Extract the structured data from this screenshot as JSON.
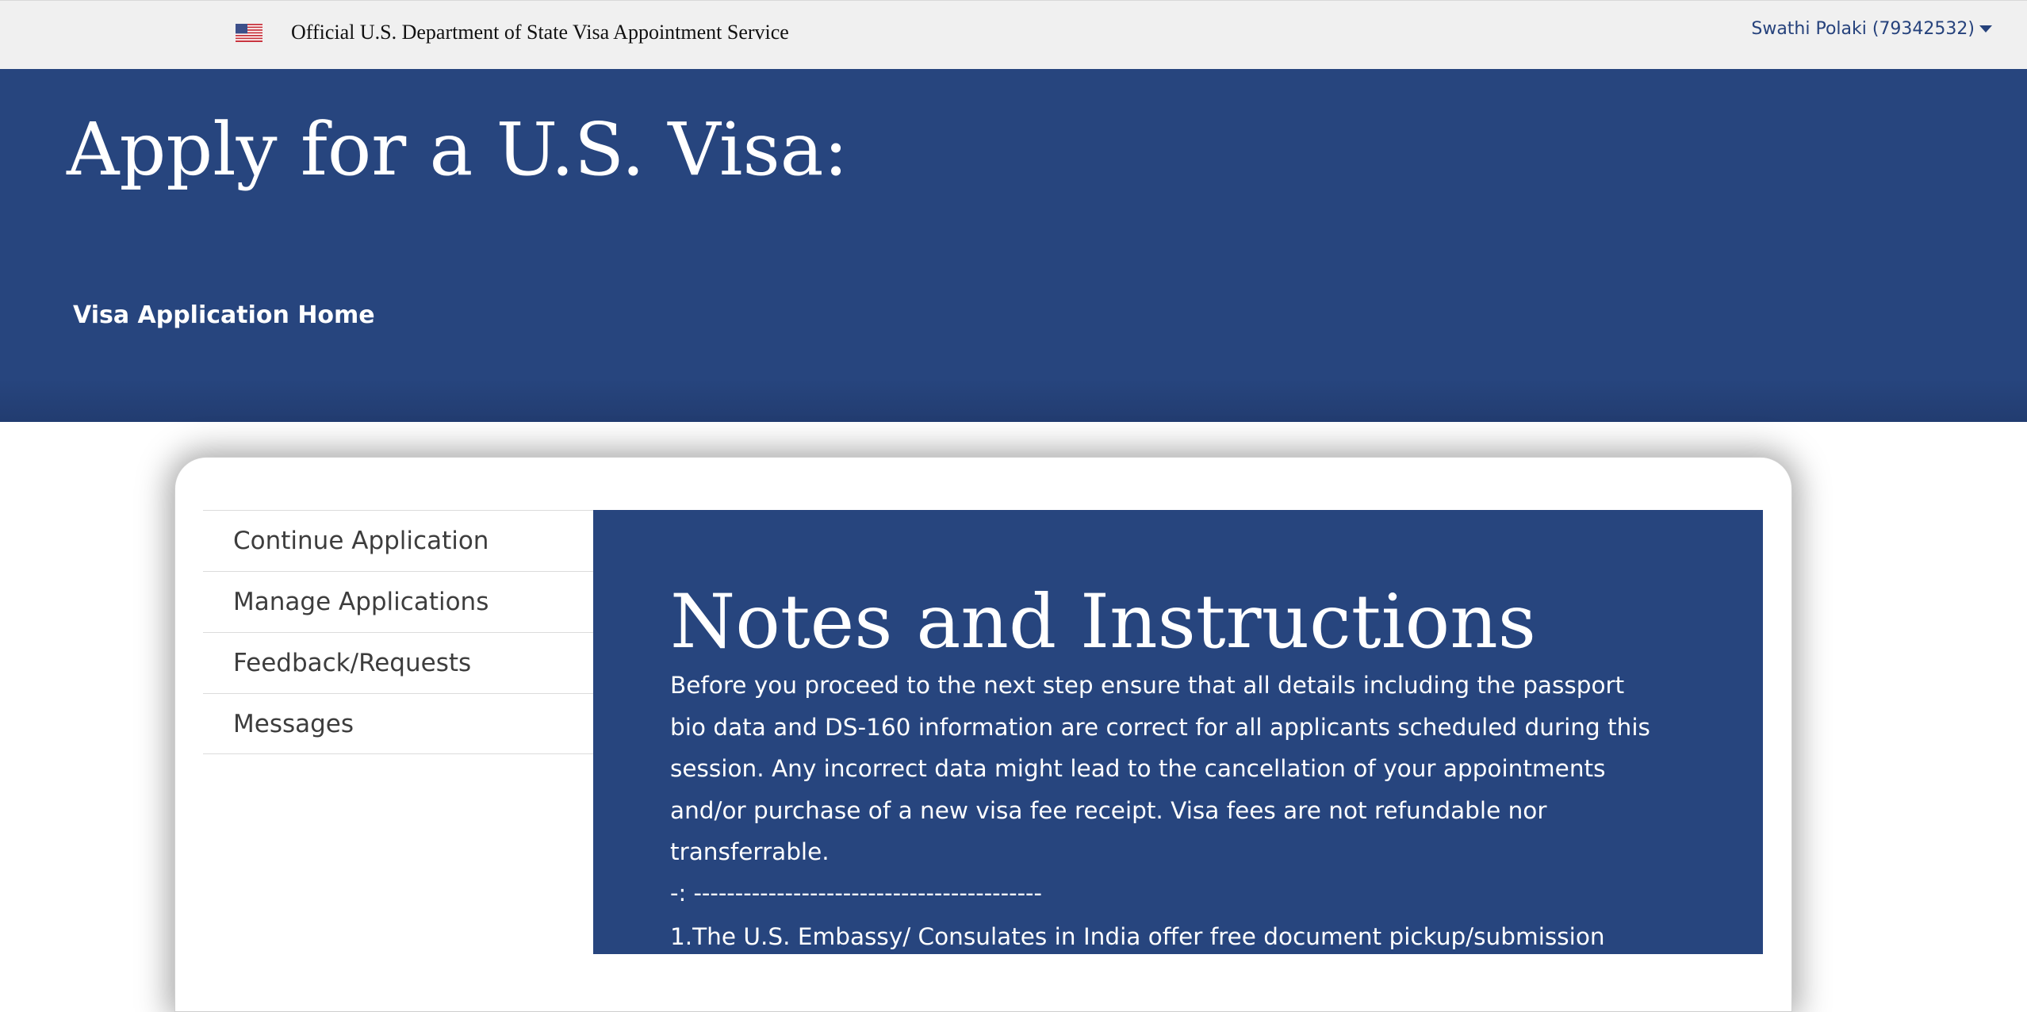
{
  "topbar": {
    "flag_icon": "us-flag-icon",
    "official_text": "Official U.S. Department of State Visa Appointment Service",
    "user_label": "Swathi Polaki (79342532)",
    "user_menu_icon": "caret-down-icon"
  },
  "hero": {
    "title": "Apply for a U.S. Visa:",
    "home_link": "Visa Application Home"
  },
  "side_nav": {
    "items": [
      {
        "label": "Continue Application"
      },
      {
        "label": "Manage Applications"
      },
      {
        "label": "Feedback/Requests"
      },
      {
        "label": "Messages"
      }
    ]
  },
  "notes": {
    "title": "Notes and Instructions",
    "body": "Before you proceed to the next step ensure that all details including the passport bio data and DS-160 information are correct for all applicants scheduled during this session. Any incorrect data might lead to the cancellation of your appointments and/or purchase of a new visa fee receipt. Visa fees are not refundable nor transferrable.",
    "separator": "-: ------------------------------------------",
    "item_1": "1.The U.S. Embassy/ Consulates in India offer free document pickup/submission"
  },
  "colors": {
    "brand_blue": "#27457e",
    "topbar_bg": "#f0f0f0",
    "nav_text": "#3d3d3d"
  }
}
